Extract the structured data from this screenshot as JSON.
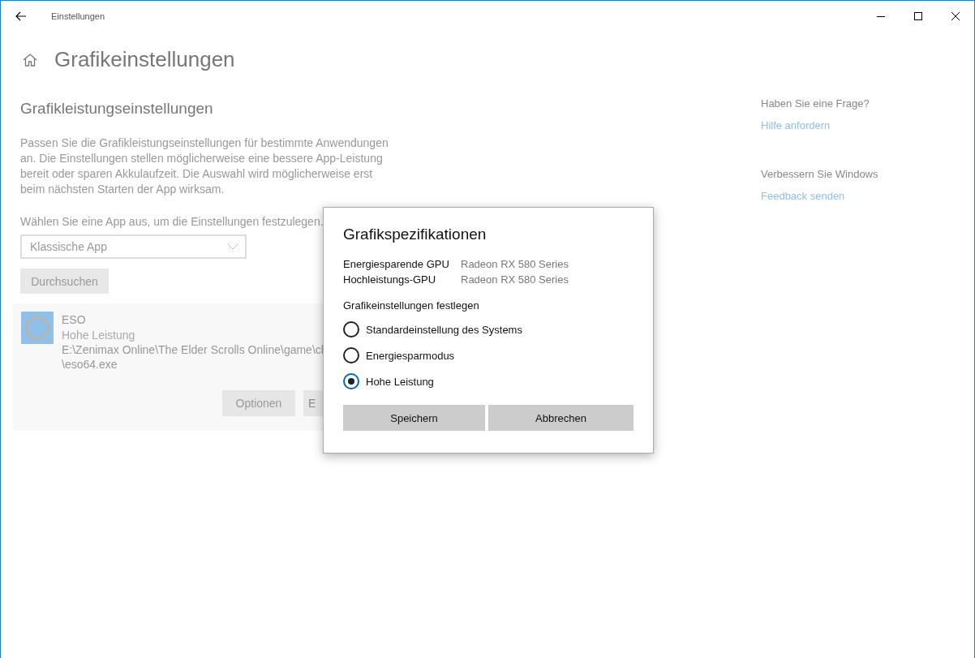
{
  "window": {
    "title": "Einstellungen"
  },
  "page": {
    "title": "Grafikeinstellungen"
  },
  "section": {
    "title": "Grafikleistungseinstellungen",
    "description": "Passen Sie die Grafikleistungseinstellungen für bestimmte Anwendungen an. Die Einstellungen stellen möglicherweise eine bessere App-Leistung bereit oder sparen Akkulaufzeit. Die Auswahl wird möglicherweise erst beim nächsten Starten der App wirksam.",
    "select_label": "Wählen Sie eine App aus, um die Einstellungen festzulegen.",
    "app_type": {
      "value": "Klassische App"
    },
    "browse_button": "Durchsuchen"
  },
  "app_card": {
    "name": "ESO",
    "mode": "Hohe Leistung",
    "path": "E:\\Zenimax Online\\The Elder Scrolls Online\\game\\cl",
    "path_cont": "\\eso64.exe",
    "buttons": [
      "Optionen",
      "E"
    ]
  },
  "sidebar": [
    {
      "heading": "Haben Sie eine Frage?",
      "link": "Hilfe anfordern"
    },
    {
      "heading": "Verbessern Sie Windows",
      "link": "Feedback senden"
    }
  ],
  "dialog": {
    "title": "Grafikspezifikationen",
    "specs": [
      {
        "label": "Energiesparende GPU",
        "value": "Radeon RX 580 Series"
      },
      {
        "label": "Hochleistungs-GPU",
        "value": "Radeon RX 580 Series"
      }
    ],
    "options_label": "Grafikeinstellungen festlegen",
    "options": [
      {
        "label": "Standardeinstellung des Systems",
        "selected": false
      },
      {
        "label": "Energiesparmodus",
        "selected": false
      },
      {
        "label": "Hohe Leistung",
        "selected": true
      }
    ],
    "buttons": [
      "Speichern",
      "Abbrechen"
    ]
  }
}
